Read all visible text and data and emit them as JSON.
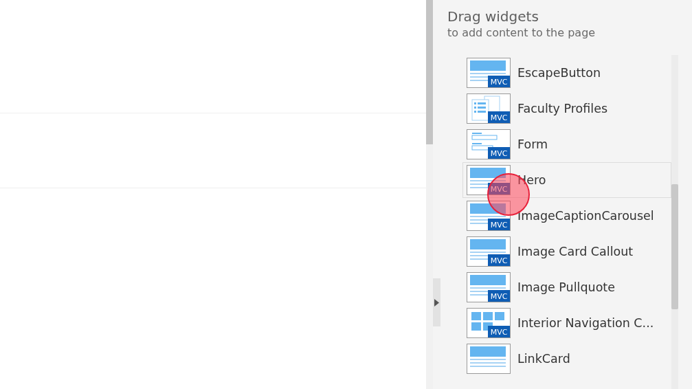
{
  "panel": {
    "title": "Drag widgets",
    "subtitle": "to add content to the page"
  },
  "widgets": [
    {
      "label": "EscapeButton",
      "kind": "banner",
      "badge": "MVC",
      "hovered": false
    },
    {
      "label": "Faculty Profiles",
      "kind": "profiles",
      "badge": "MVC",
      "hovered": false
    },
    {
      "label": "Form",
      "kind": "form",
      "badge": "MVC",
      "hovered": false
    },
    {
      "label": "Hero",
      "kind": "banner",
      "badge": "MVC",
      "hovered": true
    },
    {
      "label": "ImageCaptionCarousel",
      "kind": "banner",
      "badge": "MVC",
      "hovered": false
    },
    {
      "label": "Image Card Callout",
      "kind": "banner",
      "badge": "MVC",
      "hovered": false
    },
    {
      "label": "Image Pullquote",
      "kind": "banner",
      "badge": "MVC",
      "hovered": false
    },
    {
      "label": "Interior Navigation C...",
      "kind": "grid",
      "badge": "MVC",
      "hovered": false
    },
    {
      "label": "LinkCard",
      "kind": "banner",
      "hovered": false
    }
  ]
}
